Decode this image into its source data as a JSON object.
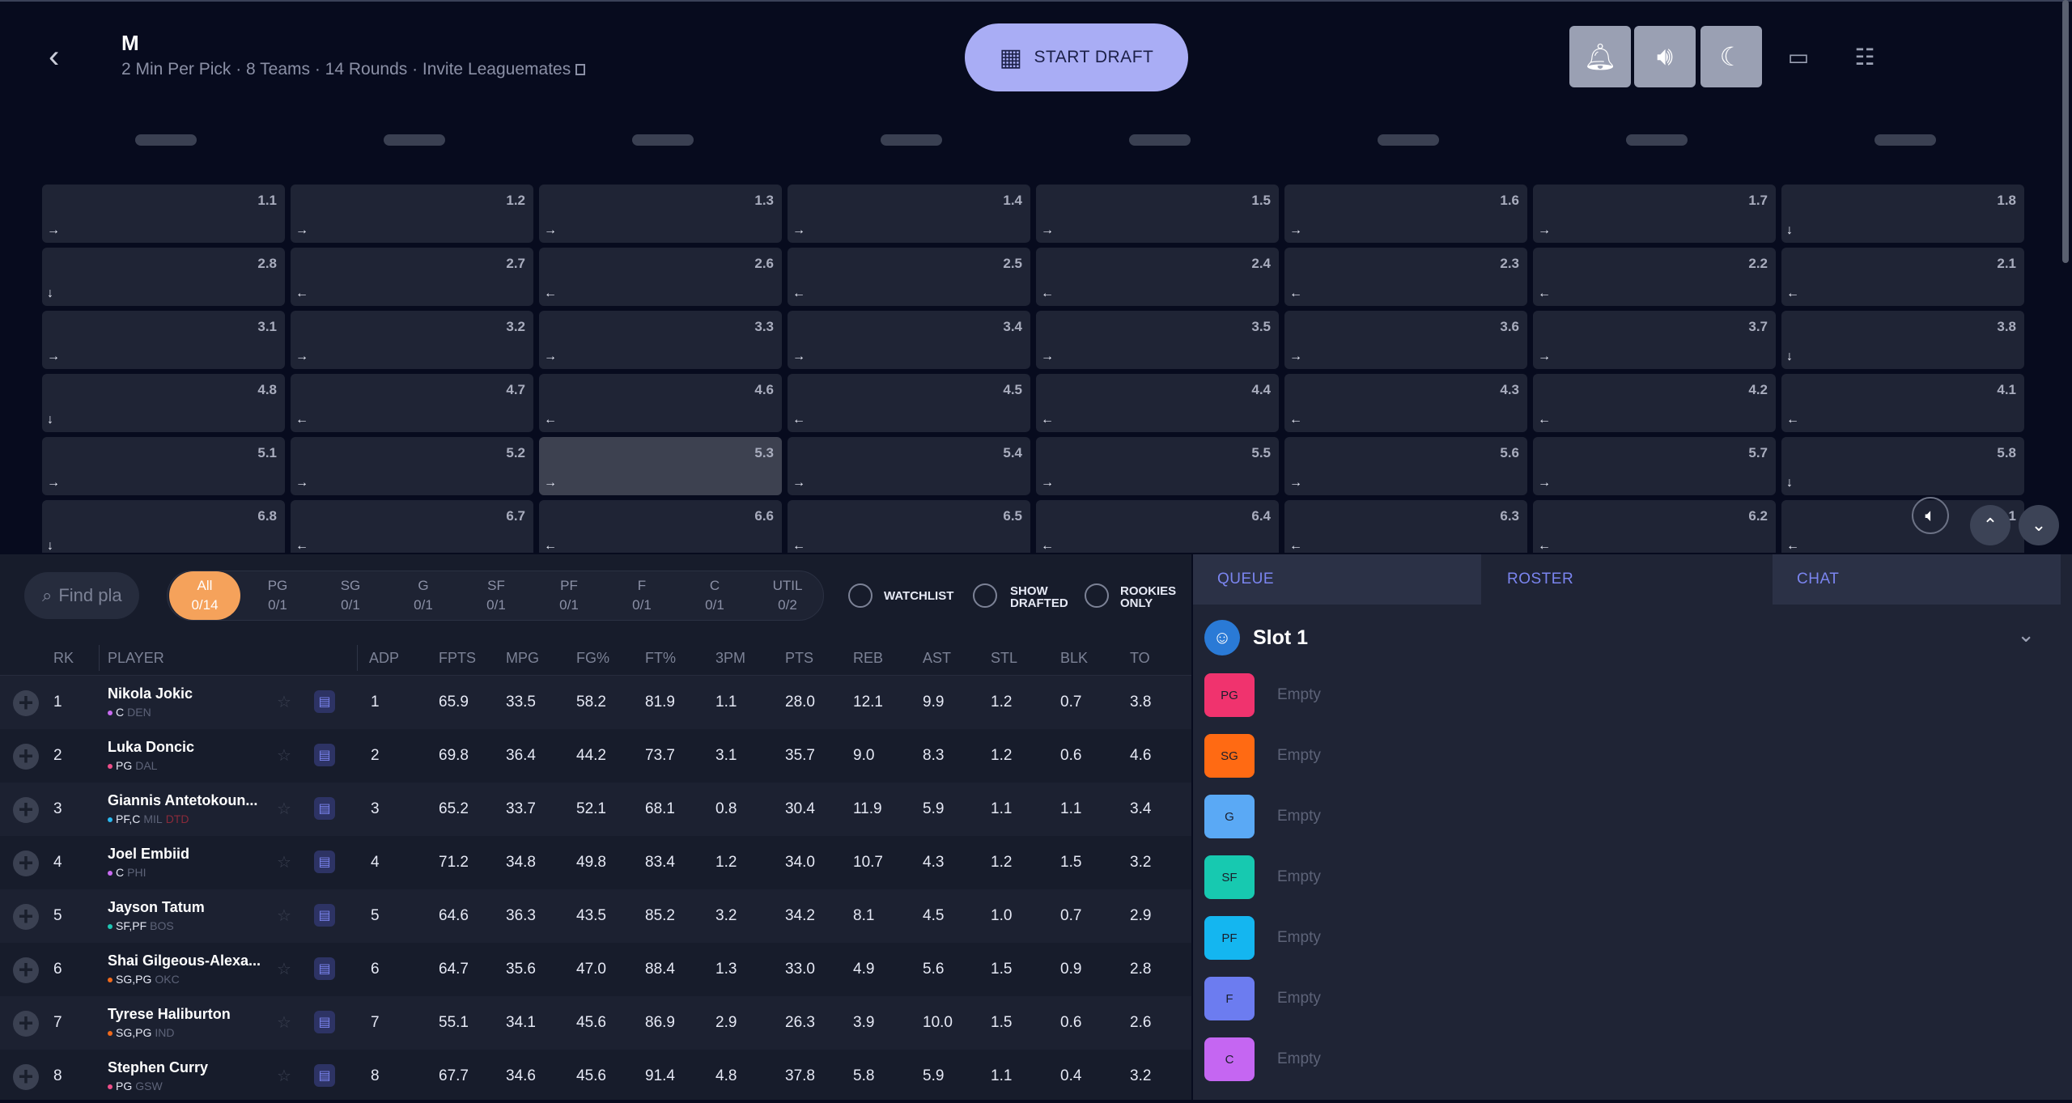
{
  "header": {
    "title": "M",
    "subtitle": "2 Min Per Pick · 8 Teams · 14 Rounds · Invite Leaguemates",
    "start_label": "START DRAFT"
  },
  "icons": {
    "back": "chevron-left-icon",
    "grid": "grid-globe-icon",
    "bell": "bell-icon",
    "volume": "volume-icon",
    "moon": "moon-icon",
    "monitor": "monitor-icon",
    "settings": "sliders-icon"
  },
  "board": {
    "rows": [
      [
        "1.1",
        "1.2",
        "1.3",
        "1.4",
        "1.5",
        "1.6",
        "1.7",
        "1.8"
      ],
      [
        "2.8",
        "2.7",
        "2.6",
        "2.5",
        "2.4",
        "2.3",
        "2.2",
        "2.1"
      ],
      [
        "3.1",
        "3.2",
        "3.3",
        "3.4",
        "3.5",
        "3.6",
        "3.7",
        "3.8"
      ],
      [
        "4.8",
        "4.7",
        "4.6",
        "4.5",
        "4.4",
        "4.3",
        "4.2",
        "4.1"
      ],
      [
        "5.1",
        "5.2",
        "5.3",
        "5.4",
        "5.5",
        "5.6",
        "5.7",
        "5.8"
      ],
      [
        "6.8",
        "6.7",
        "6.6",
        "6.5",
        "6.4",
        "6.3",
        "6.2",
        "6.1"
      ]
    ],
    "highlighted": "5.3"
  },
  "filters": {
    "search_placeholder": "Find pla",
    "positions": [
      {
        "label": "All",
        "count": "0/14"
      },
      {
        "label": "PG",
        "count": "0/1"
      },
      {
        "label": "SG",
        "count": "0/1"
      },
      {
        "label": "G",
        "count": "0/1"
      },
      {
        "label": "SF",
        "count": "0/1"
      },
      {
        "label": "PF",
        "count": "0/1"
      },
      {
        "label": "F",
        "count": "0/1"
      },
      {
        "label": "C",
        "count": "0/1"
      },
      {
        "label": "UTIL",
        "count": "0/2"
      }
    ],
    "watchlist": "WATCHLIST",
    "show_drafted_1": "SHOW",
    "show_drafted_2": "DRAFTED",
    "rookies_1": "ROOKIES",
    "rookies_2": "ONLY"
  },
  "table": {
    "columns": [
      "RK",
      "PLAYER",
      "ADP",
      "FPTS",
      "MPG",
      "FG%",
      "FT%",
      "3PM",
      "PTS",
      "REB",
      "AST",
      "STL",
      "BLK",
      "TO"
    ],
    "rows": [
      {
        "rk": "1",
        "name": "Nikola Jokic",
        "pos": "C",
        "team": "DEN",
        "tag": "",
        "dot": "#c96bf2",
        "adp": "1",
        "fpts": "65.9",
        "mpg": "33.5",
        "fg": "58.2",
        "ft": "81.9",
        "tpm": "1.1",
        "pts": "28.0",
        "reb": "12.1",
        "ast": "9.9",
        "stl": "1.2",
        "blk": "0.7",
        "to": "3.8"
      },
      {
        "rk": "2",
        "name": "Luka Doncic",
        "pos": "PG",
        "team": "DAL",
        "tag": "",
        "dot": "#ef4e8a",
        "adp": "2",
        "fpts": "69.8",
        "mpg": "36.4",
        "fg": "44.2",
        "ft": "73.7",
        "tpm": "3.1",
        "pts": "35.7",
        "reb": "9.0",
        "ast": "8.3",
        "stl": "1.2",
        "blk": "0.6",
        "to": "4.6"
      },
      {
        "rk": "3",
        "name": "Giannis Antetokoun...",
        "pos": "PF,C",
        "team": "MIL",
        "tag": "DTD",
        "dot": "#2ab8f0",
        "adp": "3",
        "fpts": "65.2",
        "mpg": "33.7",
        "fg": "52.1",
        "ft": "68.1",
        "tpm": "0.8",
        "pts": "30.4",
        "reb": "11.9",
        "ast": "5.9",
        "stl": "1.1",
        "blk": "1.1",
        "to": "3.4"
      },
      {
        "rk": "4",
        "name": "Joel Embiid",
        "pos": "C",
        "team": "PHI",
        "tag": "",
        "dot": "#c96bf2",
        "adp": "4",
        "fpts": "71.2",
        "mpg": "34.8",
        "fg": "49.8",
        "ft": "83.4",
        "tpm": "1.2",
        "pts": "34.0",
        "reb": "10.7",
        "ast": "4.3",
        "stl": "1.2",
        "blk": "1.5",
        "to": "3.2"
      },
      {
        "rk": "5",
        "name": "Jayson Tatum",
        "pos": "SF,PF",
        "team": "BOS",
        "tag": "",
        "dot": "#1fc7b5",
        "adp": "5",
        "fpts": "64.6",
        "mpg": "36.3",
        "fg": "43.5",
        "ft": "85.2",
        "tpm": "3.2",
        "pts": "34.2",
        "reb": "8.1",
        "ast": "4.5",
        "stl": "1.0",
        "blk": "0.7",
        "to": "2.9"
      },
      {
        "rk": "6",
        "name": "Shai Gilgeous-Alexa...",
        "pos": "SG,PG",
        "team": "OKC",
        "tag": "",
        "dot": "#f06a1c",
        "adp": "6",
        "fpts": "64.7",
        "mpg": "35.6",
        "fg": "47.0",
        "ft": "88.4",
        "tpm": "1.3",
        "pts": "33.0",
        "reb": "4.9",
        "ast": "5.6",
        "stl": "1.5",
        "blk": "0.9",
        "to": "2.8"
      },
      {
        "rk": "7",
        "name": "Tyrese Haliburton",
        "pos": "SG,PG",
        "team": "IND",
        "tag": "",
        "dot": "#f06a1c",
        "adp": "7",
        "fpts": "55.1",
        "mpg": "34.1",
        "fg": "45.6",
        "ft": "86.9",
        "tpm": "2.9",
        "pts": "26.3",
        "reb": "3.9",
        "ast": "10.0",
        "stl": "1.5",
        "blk": "0.6",
        "to": "2.6"
      },
      {
        "rk": "8",
        "name": "Stephen Curry",
        "pos": "PG",
        "team": "GSW",
        "tag": "",
        "dot": "#ef4e8a",
        "adp": "8",
        "fpts": "67.7",
        "mpg": "34.6",
        "fg": "45.6",
        "ft": "91.4",
        "tpm": "4.8",
        "pts": "37.8",
        "reb": "5.8",
        "ast": "5.9",
        "stl": "1.1",
        "blk": "0.4",
        "to": "3.2"
      }
    ]
  },
  "side": {
    "tabs": [
      "QUEUE",
      "ROSTER",
      "CHAT"
    ],
    "slot_label": "Slot 1",
    "roster": [
      {
        "pos": "PG",
        "color": "#f0336e",
        "value": "Empty"
      },
      {
        "pos": "SG",
        "color": "#ff6a13",
        "value": "Empty"
      },
      {
        "pos": "G",
        "color": "#5aa9f5",
        "value": "Empty"
      },
      {
        "pos": "SF",
        "color": "#17c9b0",
        "value": "Empty"
      },
      {
        "pos": "PF",
        "color": "#14b6f0",
        "value": "Empty"
      },
      {
        "pos": "F",
        "color": "#6c7cf0",
        "value": "Empty"
      },
      {
        "pos": "C",
        "color": "#c566f2",
        "value": "Empty"
      }
    ]
  }
}
